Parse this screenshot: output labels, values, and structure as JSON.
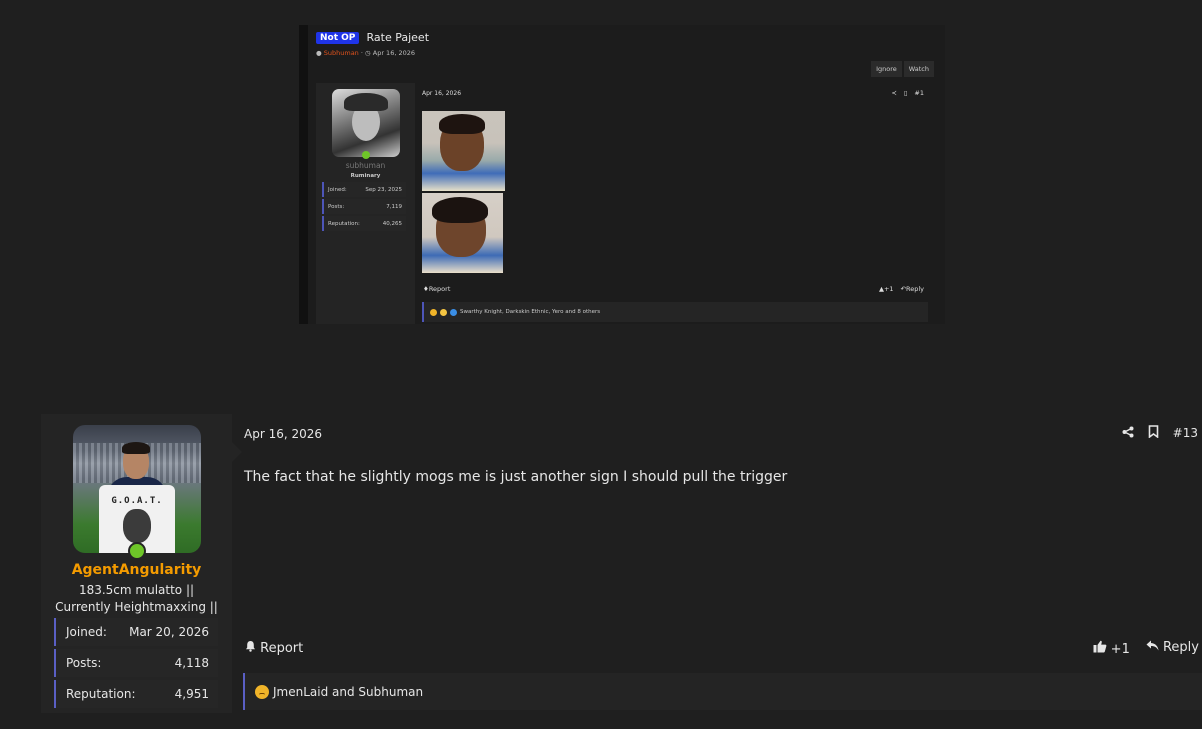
{
  "embedded_screenshot": {
    "badge": "Not OP",
    "thread_title": "Rate Pajeet",
    "author": "Subhuman",
    "thread_date": "Apr 16, 2026",
    "buttons": [
      "Ignore",
      "Watch"
    ],
    "post": {
      "username": "subhuman",
      "user_title": "Ruminary",
      "stats": [
        {
          "label": "Joined:",
          "value": "Sep 23, 2025"
        },
        {
          "label": "Posts:",
          "value": "7,119"
        },
        {
          "label": "Reputation:",
          "value": "40,265"
        }
      ],
      "date": "Apr 16, 2026",
      "post_number": "#1",
      "report": "Report",
      "like": "+1",
      "reply": "Reply",
      "reactions_text": "Swarthy Knight, Darkskin Ethnic, Yero and 8 others"
    }
  },
  "post": {
    "username": "AgentAngularity",
    "user_title": "183.5cm mulatto || Currently Heightmaxxing ||",
    "avatar_shirt_text": "G.O.A.T.",
    "stats": [
      {
        "label": "Joined:",
        "value": "Mar 20, 2026"
      },
      {
        "label": "Posts:",
        "value": "4,118"
      },
      {
        "label": "Reputation:",
        "value": "4,951"
      }
    ],
    "date": "Apr 16, 2026",
    "post_number": "#13",
    "body": "The fact that he slightly mogs me is just another sign I should pull the trigger",
    "report": "Report",
    "like_count": "+1",
    "reply": "Reply",
    "reactions_text": "JmenLaid and Subhuman"
  },
  "colors": {
    "background": "#1f1f1f",
    "username": "#f49b00",
    "accent_border": "#5a5fc4",
    "online": "#6ec628",
    "badge": "#1f34e8"
  }
}
